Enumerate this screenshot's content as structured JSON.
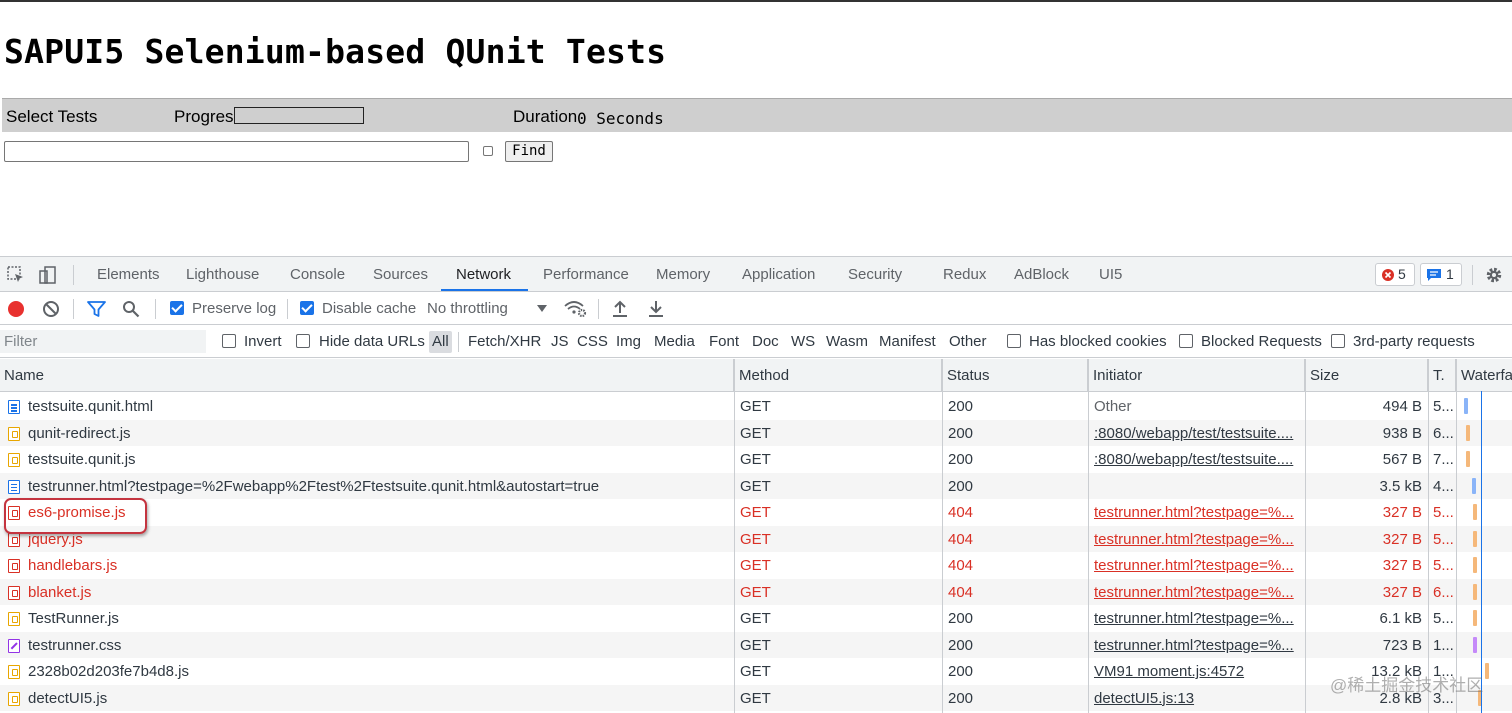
{
  "page": {
    "title": "SAPUI5 Selenium-based QUnit Tests",
    "select_tests_label": "Select Tests",
    "progress_label": "Progress",
    "duration_label": "Duration",
    "duration_value": "0 Seconds",
    "search_value": "",
    "find_button": "Find"
  },
  "devtools": {
    "tabs": [
      "Elements",
      "Lighthouse",
      "Console",
      "Sources",
      "Network",
      "Performance",
      "Memory",
      "Application",
      "Security",
      "Redux",
      "AdBlock",
      "UI5"
    ],
    "active_tab": "Network",
    "error_count": "5",
    "message_count": "1",
    "toolbar": {
      "preserve_log": "Preserve log",
      "preserve_log_checked": true,
      "disable_cache": "Disable cache",
      "disable_cache_checked": true,
      "throttling": "No throttling"
    },
    "filter": {
      "placeholder": "Filter",
      "invert": "Invert",
      "hide_data_urls": "Hide data URLs",
      "types": [
        "All",
        "Fetch/XHR",
        "JS",
        "CSS",
        "Img",
        "Media",
        "Font",
        "Doc",
        "WS",
        "Wasm",
        "Manifest",
        "Other"
      ],
      "has_blocked_cookies": "Has blocked cookies",
      "blocked_requests": "Blocked Requests",
      "third_party": "3rd-party requests"
    },
    "columns": [
      "Name",
      "Method",
      "Status",
      "Initiator",
      "Size",
      "T.",
      "Waterfa"
    ],
    "rows": [
      {
        "name": "testsuite.qunit.html",
        "method": "GET",
        "status": "200",
        "initiator": "Other",
        "size": "494 B",
        "time": "5...",
        "type": "doc",
        "error": false,
        "link": false
      },
      {
        "name": "qunit-redirect.js",
        "method": "GET",
        "status": "200",
        "initiator": ":8080/webapp/test/testsuite....",
        "size": "938 B",
        "time": "6...",
        "type": "js",
        "error": false,
        "link": true
      },
      {
        "name": "testsuite.qunit.js",
        "method": "GET",
        "status": "200",
        "initiator": ":8080/webapp/test/testsuite....",
        "size": "567 B",
        "time": "7...",
        "type": "js",
        "error": false,
        "link": true
      },
      {
        "name": "testrunner.html?testpage=%2Fwebapp%2Ftest%2Ftestsuite.qunit.html&autostart=true",
        "method": "GET",
        "status": "200",
        "initiator": "",
        "size": "3.5 kB",
        "time": "4...",
        "type": "doc",
        "error": false,
        "link": false
      },
      {
        "name": "es6-promise.js",
        "method": "GET",
        "status": "404",
        "initiator": "testrunner.html?testpage=%...",
        "size": "327 B",
        "time": "5...",
        "type": "jserr",
        "error": true,
        "link": true
      },
      {
        "name": "jquery.js",
        "method": "GET",
        "status": "404",
        "initiator": "testrunner.html?testpage=%...",
        "size": "327 B",
        "time": "5...",
        "type": "jserr",
        "error": true,
        "link": true
      },
      {
        "name": "handlebars.js",
        "method": "GET",
        "status": "404",
        "initiator": "testrunner.html?testpage=%...",
        "size": "327 B",
        "time": "5...",
        "type": "jserr",
        "error": true,
        "link": true
      },
      {
        "name": "blanket.js",
        "method": "GET",
        "status": "404",
        "initiator": "testrunner.html?testpage=%...",
        "size": "327 B",
        "time": "6...",
        "type": "jserr",
        "error": true,
        "link": true
      },
      {
        "name": "TestRunner.js",
        "method": "GET",
        "status": "200",
        "initiator": "testrunner.html?testpage=%...",
        "size": "6.1 kB",
        "time": "5...",
        "type": "js",
        "error": false,
        "link": true
      },
      {
        "name": "testrunner.css",
        "method": "GET",
        "status": "200",
        "initiator": "testrunner.html?testpage=%...",
        "size": "723 B",
        "time": "1...",
        "type": "css",
        "error": false,
        "link": true
      },
      {
        "name": "2328b02d203fe7b4d8.js",
        "method": "GET",
        "status": "200",
        "initiator": "VM91 moment.js:4572",
        "size": "13.2 kB",
        "time": "1...",
        "type": "js",
        "error": false,
        "link": true
      },
      {
        "name": "detectUI5.js",
        "method": "GET",
        "status": "200",
        "initiator": "detectUI5.js:13",
        "size": "2.8 kB",
        "time": "3...",
        "type": "js",
        "error": false,
        "link": true
      }
    ]
  },
  "watermark": "@稀土掘金技术社区",
  "colors": {
    "accent": "#1a73e8",
    "error": "#d93025",
    "record": "#e8312f",
    "highlight_ring": "#c4343f"
  }
}
